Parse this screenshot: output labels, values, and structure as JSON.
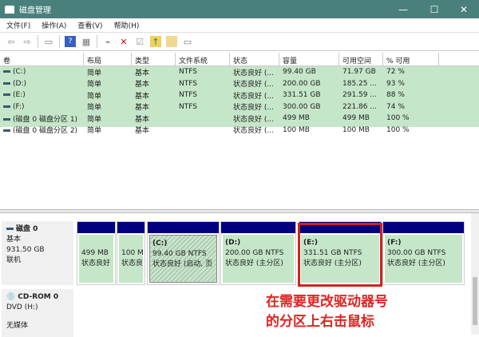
{
  "window": {
    "title": "磁盘管理",
    "minimize": "—",
    "maximize": "☐",
    "close": "✕"
  },
  "menu": [
    "文件(F)",
    "操作(A)",
    "查看(V)",
    "帮助(H)"
  ],
  "toolbar": [
    "back-icon",
    "forward-icon",
    "properties-icon",
    "help-icon",
    "list-icon",
    "connect-icon",
    "delete-icon",
    "check-icon",
    "import-icon",
    "folder-icon",
    "console-icon"
  ],
  "table": {
    "headers": [
      "卷",
      "布局",
      "类型",
      "文件系统",
      "状态",
      "容量",
      "可用空间",
      "% 可用"
    ],
    "rows": [
      [
        "(C:)",
        "简单",
        "基本",
        "NTFS",
        "状态良好 (...",
        "99.40 GB",
        "71.97 GB",
        "72 %"
      ],
      [
        "(D:)",
        "简单",
        "基本",
        "NTFS",
        "状态良好 (...",
        "200.00 GB",
        "185.25 ...",
        "93 %"
      ],
      [
        "(E:)",
        "简单",
        "基本",
        "NTFS",
        "状态良好 (...",
        "331.51 GB",
        "291.59 ...",
        "88 %"
      ],
      [
        "(F:)",
        "简单",
        "基本",
        "NTFS",
        "状态良好 (...",
        "300.00 GB",
        "221.86 ...",
        "74 %"
      ],
      [
        "(磁盘 0 磁盘分区 1)",
        "简单",
        "基本",
        "",
        "状态良好 (...",
        "499 MB",
        "499 MB",
        "100 %"
      ],
      [
        "(磁盘 0 磁盘分区 2)",
        "简单",
        "基本",
        "",
        "状态良好 (...",
        "100 MB",
        "100 MB",
        "100 %"
      ]
    ]
  },
  "disk0": {
    "name": "磁盘 0",
    "type": "基本",
    "size": "931.50 GB",
    "status": "联机",
    "partitions": [
      {
        "label": "",
        "line1": "499 MB",
        "line2": "状态良好"
      },
      {
        "label": "",
        "line1": "100 M",
        "line2": "状态良"
      },
      {
        "label": "(C:)",
        "line1": "99.40 GB NTFS",
        "line2": "状态良好 (启动, 页"
      },
      {
        "label": "(D:)",
        "line1": "200.00 GB NTFS",
        "line2": "状态良好 (主分区)"
      },
      {
        "label": "(E:)",
        "line1": "331.51 GB NTFS",
        "line2": "状态良好 (主分区)"
      },
      {
        "label": "(F:)",
        "line1": "300.00 GB NTFS",
        "line2": "状态良好 (主分区)"
      }
    ]
  },
  "cdrom": {
    "name": "CD-ROM 0",
    "type": "DVD (H:)",
    "status": "无媒体"
  },
  "annotation": {
    "line1": "在需要更改驱动器号",
    "line2": "的分区上右击鼠标"
  }
}
